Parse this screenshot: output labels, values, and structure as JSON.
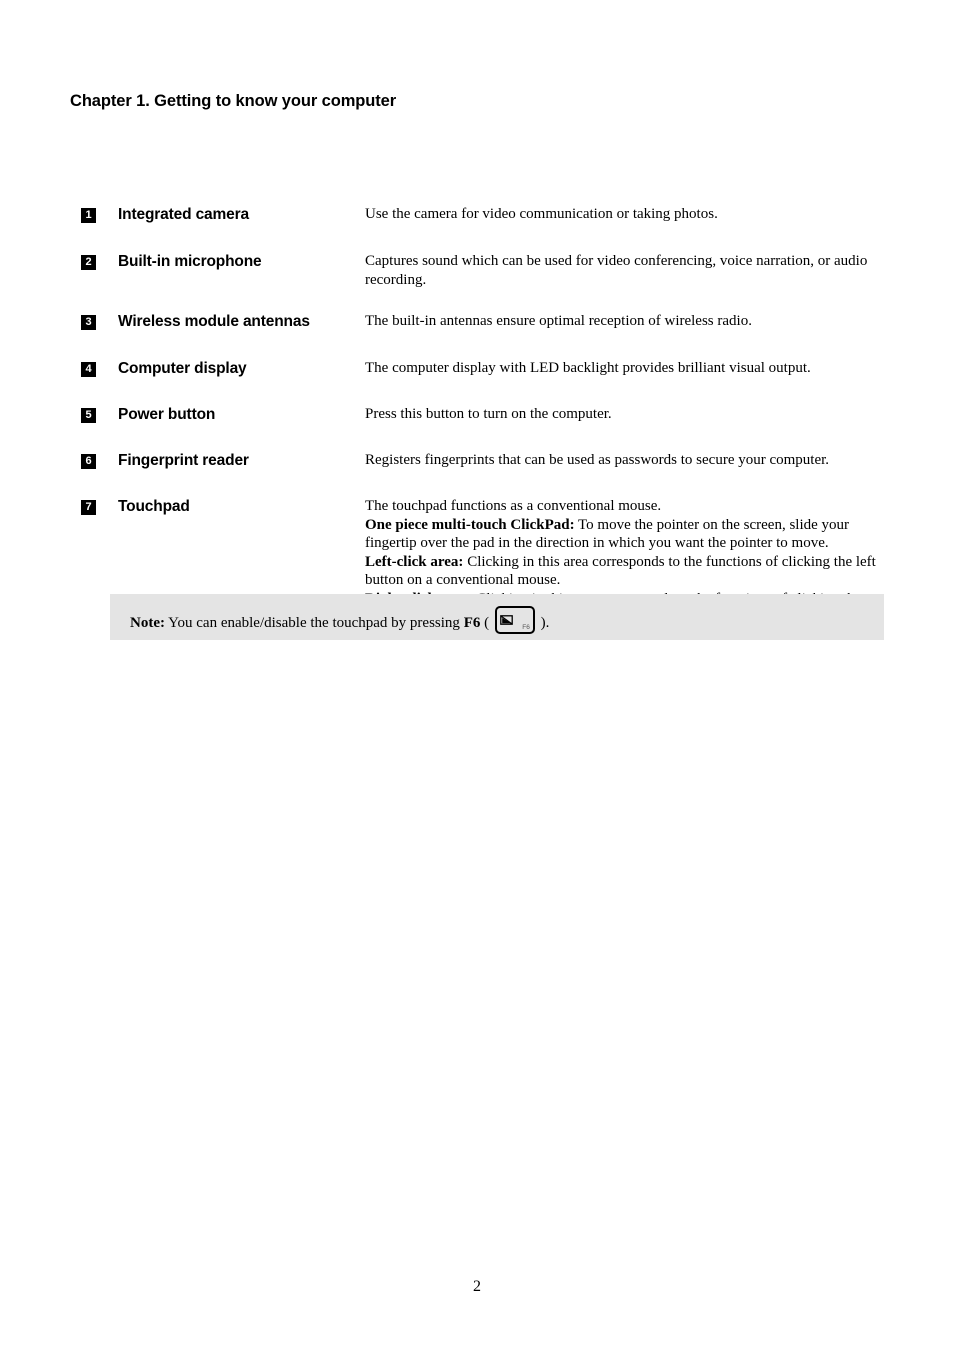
{
  "document": {
    "chapter_title": "Chapter 1. Getting to know your computer",
    "page_number": "2"
  },
  "features": [
    {
      "badge": "1",
      "label": "Integrated camera",
      "lines": [
        {
          "text": "Use the camera for video communication or taking photos."
        }
      ]
    },
    {
      "badge": "2",
      "label": "Built-in microphone",
      "lines": [
        {
          "text": "Captures sound which can be used for video conferencing, voice narration, or audio recording."
        }
      ]
    },
    {
      "badge": "3",
      "label": "Wireless module antennas",
      "lines": [
        {
          "text": "The built-in antennas ensure optimal reception of wireless radio."
        }
      ]
    },
    {
      "badge": "4",
      "label": "Computer display",
      "lines": [
        {
          "text": "The computer display with LED backlight provides brilliant visual output."
        }
      ]
    },
    {
      "badge": "5",
      "label": "Power button",
      "lines": [
        {
          "text": "Press this button to turn on the computer."
        }
      ]
    },
    {
      "badge": "6",
      "label": "Fingerprint reader",
      "lines": [
        {
          "text": "Registers fingerprints that can be used as passwords to secure your computer."
        }
      ]
    },
    {
      "badge": "7",
      "label": "Touchpad",
      "lines": [
        {
          "text": "The touchpad functions as a conventional mouse."
        },
        {
          "lead": "One piece multi-touch ClickPad:",
          "text": " To move the pointer on the screen, slide your fingertip over the pad in the direction in which you want the pointer to move."
        },
        {
          "lead": "Left-click area:",
          "text": " Clicking in this area corresponds to the functions of clicking the left button on a conventional mouse."
        },
        {
          "lead": "Right-click area:",
          "text": " Clicking in this area corresponds to the functions of clicking the right button on a conventional mouse."
        }
      ]
    }
  ],
  "note": {
    "label": "Note:",
    "text_before_key": " You can enable/disable the touchpad by pressing ",
    "key_name": "F6",
    "open_paren": " ( ",
    "keycap_fn_label": "F6",
    "close_paren": " ).",
    "background_color": "#e4e4e4"
  }
}
